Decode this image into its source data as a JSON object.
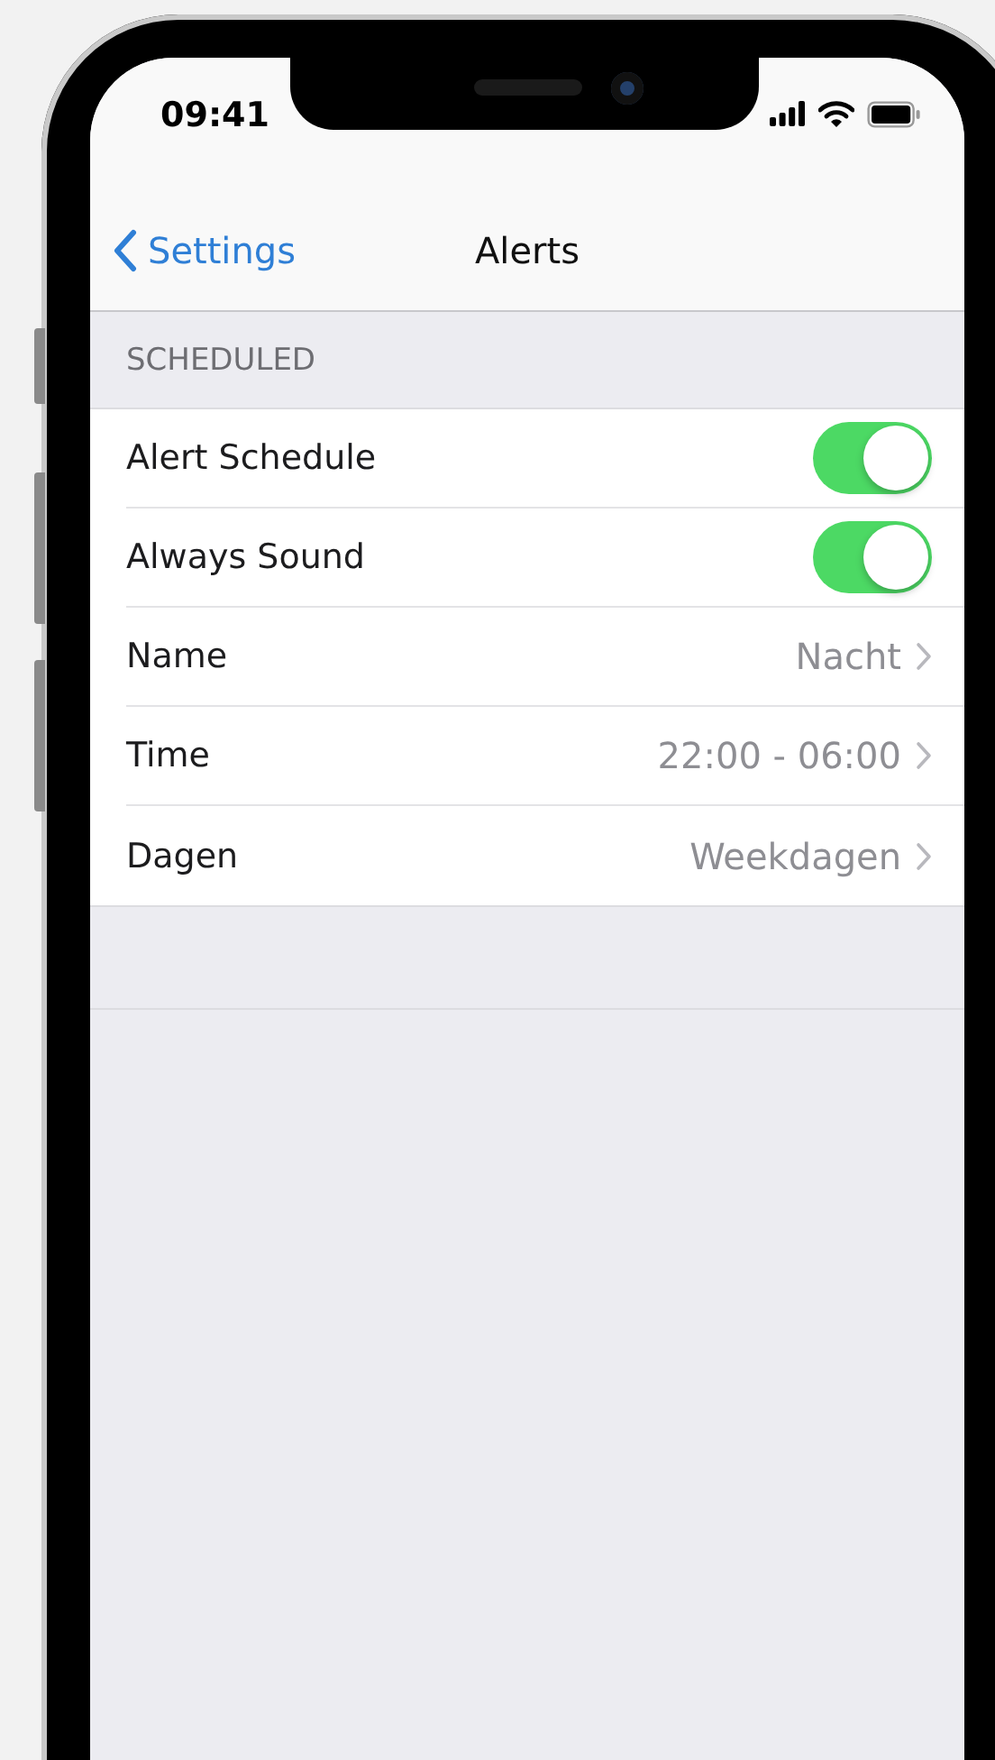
{
  "status_bar": {
    "time": "09:41"
  },
  "nav_bar": {
    "back_label": "Settings",
    "title": "Alerts"
  },
  "section": {
    "header": "SCHEDULED",
    "rows": [
      {
        "kind": "toggle",
        "label": "Alert Schedule",
        "on": true
      },
      {
        "kind": "toggle",
        "label": "Always Sound",
        "on": true
      },
      {
        "kind": "disclosure",
        "label": "Name",
        "value": "Nacht"
      },
      {
        "kind": "disclosure",
        "label": "Time",
        "value": "22:00 - 06:00"
      },
      {
        "kind": "disclosure",
        "label": "Dagen",
        "value": "Weekdagen"
      }
    ]
  }
}
